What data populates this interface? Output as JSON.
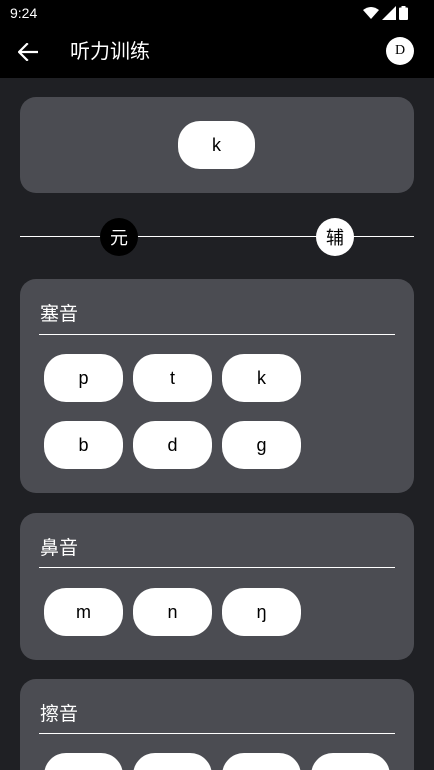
{
  "status": {
    "time": "9:24"
  },
  "app": {
    "title": "听力训练",
    "avatar_letter": "D"
  },
  "current": {
    "sound": "k"
  },
  "toggle": {
    "vowel_label": "元",
    "consonant_label": "辅",
    "selected": "辅"
  },
  "sections": [
    {
      "title": "塞音",
      "sounds": [
        "p",
        "t",
        "k",
        "b",
        "d",
        "g"
      ]
    },
    {
      "title": "鼻音",
      "sounds": [
        "m",
        "n",
        "ŋ"
      ]
    },
    {
      "title": "擦音",
      "sounds": [
        "",
        "",
        "",
        ""
      ]
    }
  ],
  "icons": {
    "back": "arrow-left-icon",
    "wifi": "wifi-icon",
    "signal": "signal-icon",
    "battery": "battery-icon"
  }
}
